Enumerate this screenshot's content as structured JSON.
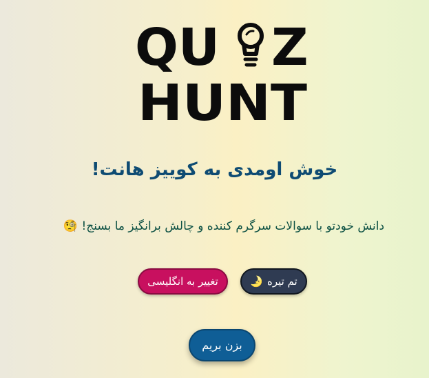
{
  "logo": {
    "line1_left": "QU",
    "line1_right": "Z",
    "line2": "HUNT",
    "bulb_icon": "lightbulb-icon"
  },
  "main": {
    "welcome": "خوش اومدی به کوییز هانت!",
    "subtitle": "دانش خودتو با سوالات سرگرم کننده و چالش برانگیز ما بسنج! 🧐"
  },
  "buttons": {
    "theme_label": "تم تیره",
    "theme_icon": "🌛",
    "language_label": "تغییر به انگلیسی",
    "start_label": "بزن بریم"
  },
  "colors": {
    "title": "#0e4b73",
    "subtitle": "#0d5144",
    "theme_button": "#2f3b52",
    "language_button": "#c8105f",
    "start_button": "#0f5e96"
  }
}
